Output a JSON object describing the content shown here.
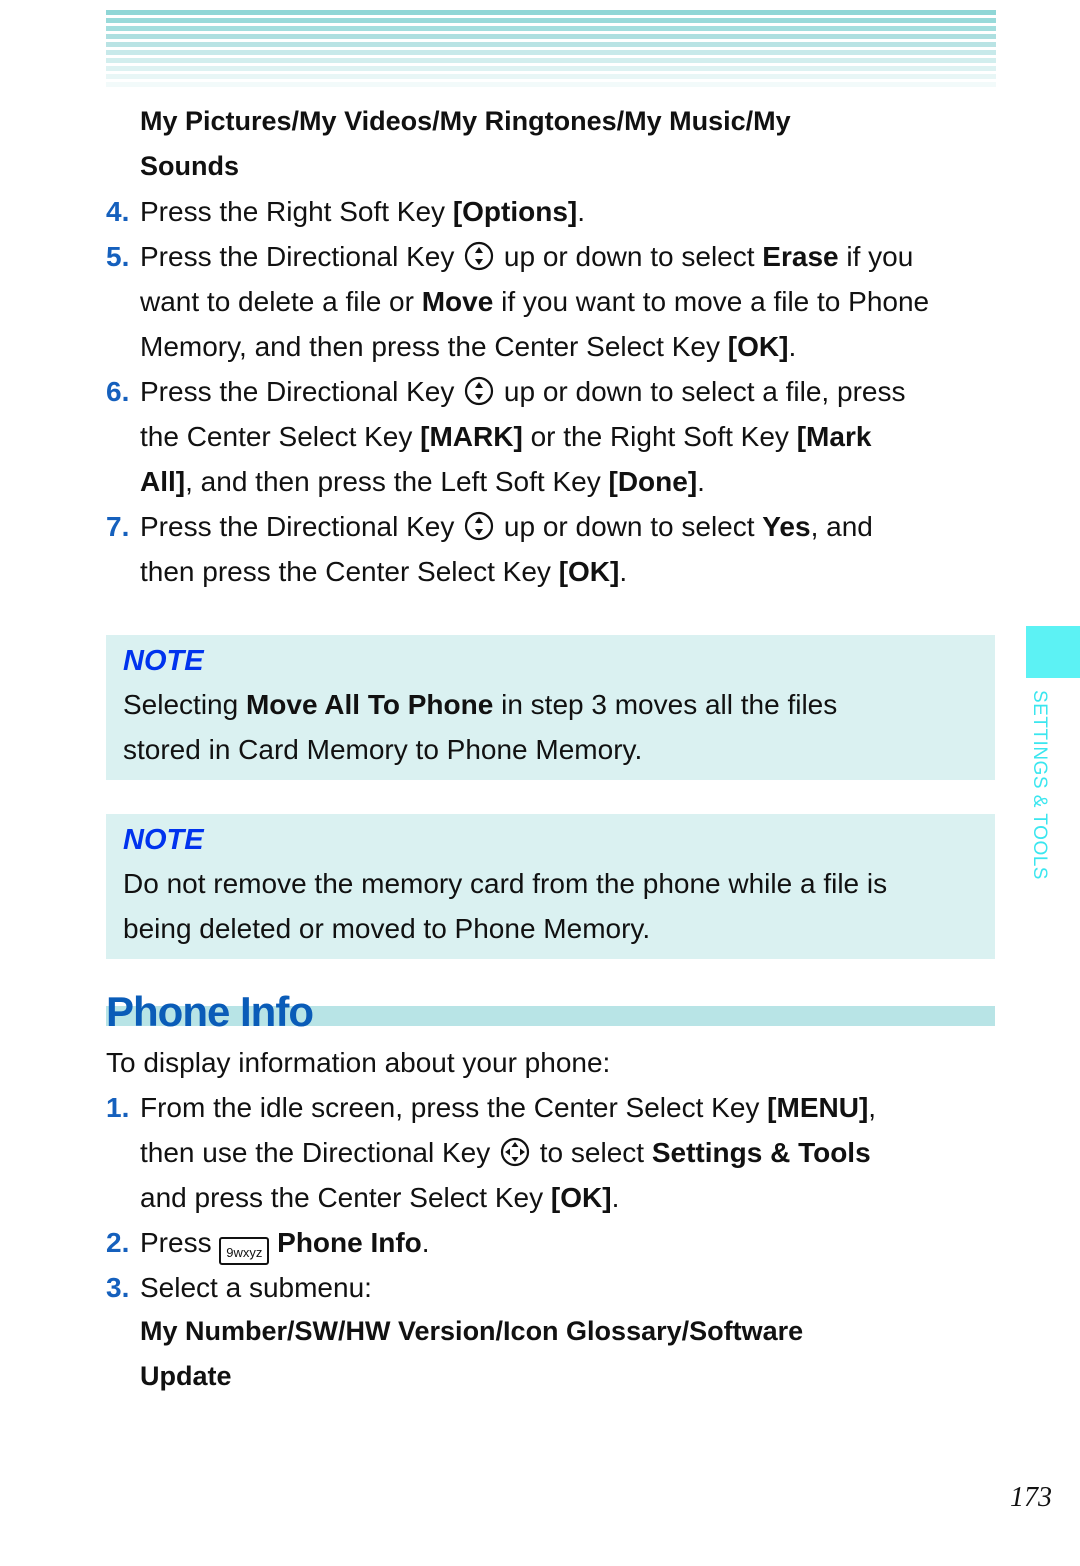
{
  "header_stripes": {
    "colors": [
      "#8fd6d6",
      "#99dada",
      "#a3dede",
      "#addfe0",
      "#b9e3e4",
      "#c7e9ea",
      "#d2eeee",
      "#ddf2f2",
      "#e8f6f6",
      "#f2fafa"
    ]
  },
  "section1": {
    "submenu_line1": "My Pictures/My Videos/My Ringtones/My Music/My",
    "submenu_line2": "Sounds",
    "steps": [
      {
        "num": "4.",
        "lines": [
          {
            "parts": [
              "Press the Right Soft Key ",
              "[Options]",
              "."
            ]
          }
        ]
      },
      {
        "num": "5.",
        "lines": [
          {
            "parts": [
              "Press the Directional Key ",
              " up or down to select ",
              "Erase",
              " if you"
            ]
          },
          {
            "parts": [
              "want to delete a file or ",
              "Move",
              " if you want to move a file to Phone"
            ]
          },
          {
            "parts": [
              "Memory, and then press the Center Select Key ",
              "[OK]",
              "."
            ]
          }
        ]
      },
      {
        "num": "6.",
        "lines": [
          {
            "parts": [
              "Press the Directional Key ",
              " up or down to select a file, press"
            ]
          },
          {
            "parts": [
              "the Center Select Key ",
              "[MARK]",
              " or the Right Soft Key ",
              "[Mark"
            ]
          },
          {
            "parts": [
              "All]",
              ", and then press the Left Soft Key ",
              "[Done]",
              "."
            ]
          }
        ]
      },
      {
        "num": "7.",
        "lines": [
          {
            "parts": [
              "Press the Directional Key ",
              " up or down to select ",
              "Yes",
              ", and"
            ]
          },
          {
            "parts": [
              "then press the Center Select Key ",
              "[OK]",
              "."
            ]
          }
        ]
      }
    ]
  },
  "notes": [
    {
      "title": "NOTE",
      "line1": [
        "Selecting ",
        "Move All To Phone",
        " in step 3 moves all the files"
      ],
      "line2": "stored in Card Memory to Phone Memory."
    },
    {
      "title": "NOTE",
      "line1": [
        "Do not remove the memory card from the phone while a file is"
      ],
      "line2": "being deleted or moved to Phone Memory."
    }
  ],
  "phone_info": {
    "heading": "Phone Info",
    "intro": "To display information about your phone:",
    "step1": {
      "num": "1.",
      "l1": [
        "From the idle screen, press the Center Select Key ",
        "[MENU]",
        ","
      ],
      "l2": [
        "then use the Directional Key ",
        " to select ",
        "Settings & Tools"
      ],
      "l3": [
        "and press the Center Select Key ",
        "[OK]",
        "."
      ]
    },
    "step2": {
      "num": "2.",
      "pre": "Press ",
      "key_label": "9wxyz",
      "bold": "Phone Info",
      "post": "."
    },
    "step3": {
      "num": "3.",
      "text": "Select a submenu:"
    },
    "submenu_line1": "My Number/SW/HW Version/Icon Glossary/Software",
    "submenu_line2": "Update"
  },
  "side_tab": {
    "label": "SETTINGS & TOOLS",
    "color": "#5cf2f4"
  },
  "page_number": "173"
}
